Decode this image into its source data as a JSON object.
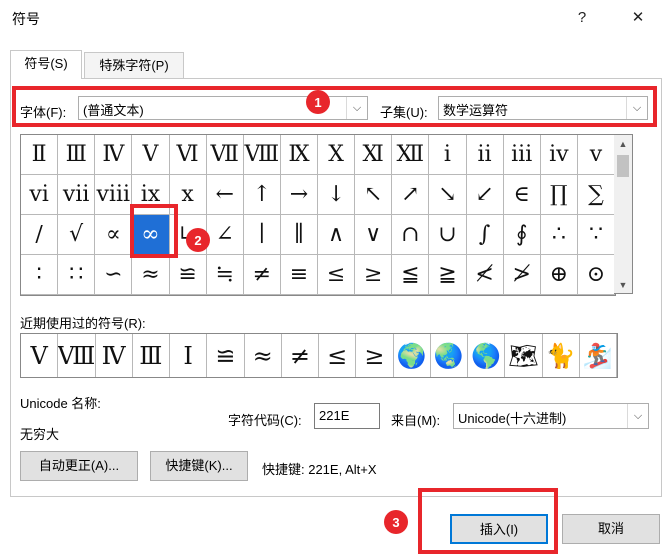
{
  "window": {
    "title": "符号",
    "help": "?",
    "close": "✕"
  },
  "tabs": [
    {
      "label": "符号(S)",
      "active": true
    },
    {
      "label": "特殊字符(P)",
      "active": false
    }
  ],
  "font": {
    "label": "字体(F):",
    "value": "(普通文本)"
  },
  "subset": {
    "label": "子集(U):",
    "value": "数学运算符"
  },
  "symbols": [
    [
      "Ⅱ",
      "Ⅲ",
      "Ⅳ",
      "Ⅴ",
      "Ⅵ",
      "Ⅶ",
      "Ⅷ",
      "Ⅸ",
      "Ⅹ",
      "Ⅺ",
      "Ⅻ",
      "ⅰ",
      "ⅱ",
      "ⅲ",
      "ⅳ",
      "ⅴ"
    ],
    [
      "ⅵ",
      "ⅶ",
      "ⅷ",
      "ⅸ",
      "ⅹ",
      "←",
      "↑",
      "→",
      "↓",
      "↖",
      "↗",
      "↘",
      "↙",
      "∈",
      "∏",
      "∑"
    ],
    [
      "∕",
      "√",
      "∝",
      "∞",
      "∟",
      "∠",
      "∣",
      "∥",
      "∧",
      "∨",
      "∩",
      "∪",
      "∫",
      "∮",
      "∴",
      "∵"
    ],
    [
      "∶",
      "∷",
      "∽",
      "≈",
      "≌",
      "≒",
      "≠",
      "≡",
      "≤",
      "≥",
      "≦",
      "≧",
      "≮",
      "≯",
      "⊕",
      "⊙"
    ]
  ],
  "selected": {
    "row": 2,
    "col": 3
  },
  "recent": {
    "label": "近期使用过的符号(R):",
    "items": [
      "Ⅴ",
      "Ⅷ",
      "Ⅳ",
      "Ⅲ",
      "Ⅰ",
      "≌",
      "≈",
      "≠",
      "≤",
      "≥",
      "🌍",
      "🌏",
      "🌎",
      "🗺",
      "🐈",
      "🏂"
    ]
  },
  "unicode_name": {
    "label": "Unicode 名称:",
    "value": "无穷大"
  },
  "char_code": {
    "label": "字符代码(C):",
    "value": "221E"
  },
  "from": {
    "label": "来自(M):",
    "value": "Unicode(十六进制)"
  },
  "buttons": {
    "autocorrect": "自动更正(A)...",
    "shortcut_key": "快捷键(K)...",
    "shortcut_text": "快捷键: 221E, Alt+X",
    "insert": "插入(I)",
    "cancel": "取消"
  },
  "annotations": [
    "1",
    "2",
    "3"
  ],
  "colors": {
    "annotation": "#e8262b",
    "selection": "#1f6fd6"
  }
}
